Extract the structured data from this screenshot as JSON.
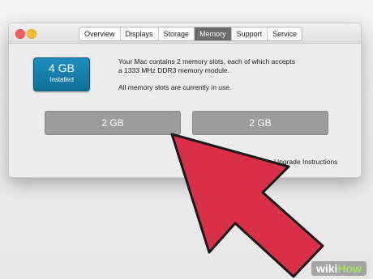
{
  "tabs": [
    {
      "label": "Overview"
    },
    {
      "label": "Displays"
    },
    {
      "label": "Storage"
    },
    {
      "label": "Memory",
      "active": true
    },
    {
      "label": "Support"
    },
    {
      "label": "Service"
    }
  ],
  "memory_summary": {
    "size": "4 GB",
    "status": "Installed"
  },
  "info": {
    "line1": "Your Mac contains 2 memory slots, each of which accepts",
    "line2": "a 1333 MHz DDR3 memory module.",
    "line3": "All memory slots are currently in use."
  },
  "slots": [
    "2 GB",
    "2 GB"
  ],
  "upgrade_link": "Upgrade Instructions",
  "watermark": {
    "part1": "wiki",
    "part2": "How"
  },
  "colors": {
    "arrow": "#d92f47",
    "arrow_outline": "#1a1a1a",
    "memory_icon": "#1581b0",
    "active_tab": "#6b6b6b",
    "slot": "#9c9c9c"
  }
}
